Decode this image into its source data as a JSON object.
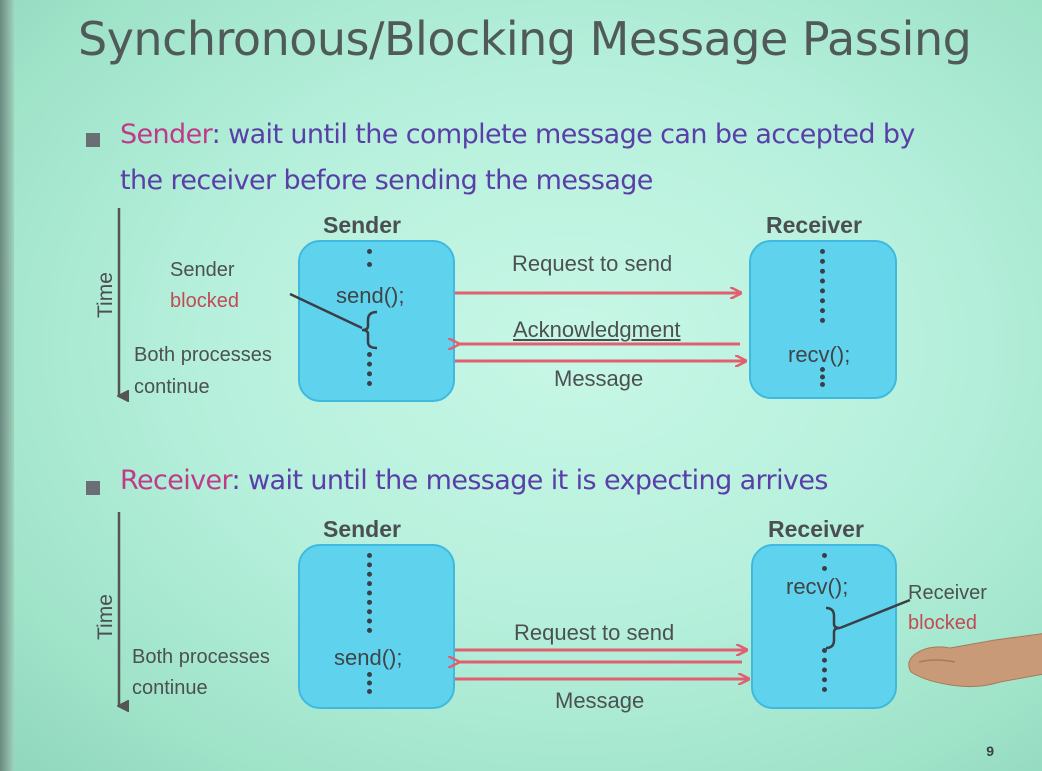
{
  "title": "Synchronous/Blocking Message Passing",
  "bullet1": {
    "keyword": "Sender",
    "text": ": wait until the complete message can be accepted by",
    "text2": "the receiver before sending the message"
  },
  "bullet2": {
    "keyword": "Receiver",
    "text": ": wait until the message it is expecting arrives"
  },
  "diagram1": {
    "sender_header": "Sender",
    "receiver_header": "Receiver",
    "time_label": "Time",
    "side_label_1": "Sender",
    "side_label_2": "blocked",
    "side_label_3": "Both processes",
    "side_label_4": "continue",
    "sender_code": "send();",
    "receiver_code": "recv();",
    "arrow_1": "Request to send",
    "arrow_2": "Acknowledgment",
    "arrow_3": "Message"
  },
  "diagram2": {
    "sender_header": "Sender",
    "receiver_header": "Receiver",
    "time_label": "Time",
    "side_label_1": "Both processes",
    "side_label_2": "continue",
    "sender_code": "send();",
    "receiver_code": "recv();",
    "recv_label_1": "Receiver",
    "recv_label_2": "blocked",
    "arrow_1": "Request to send",
    "arrow_2": "Message"
  },
  "page_number": "9",
  "colors": {
    "box_fill": "#5fd3ee",
    "arrow": "#e06070",
    "keyword": "#c03a8a",
    "bullet_text": "#5a3fa8"
  }
}
